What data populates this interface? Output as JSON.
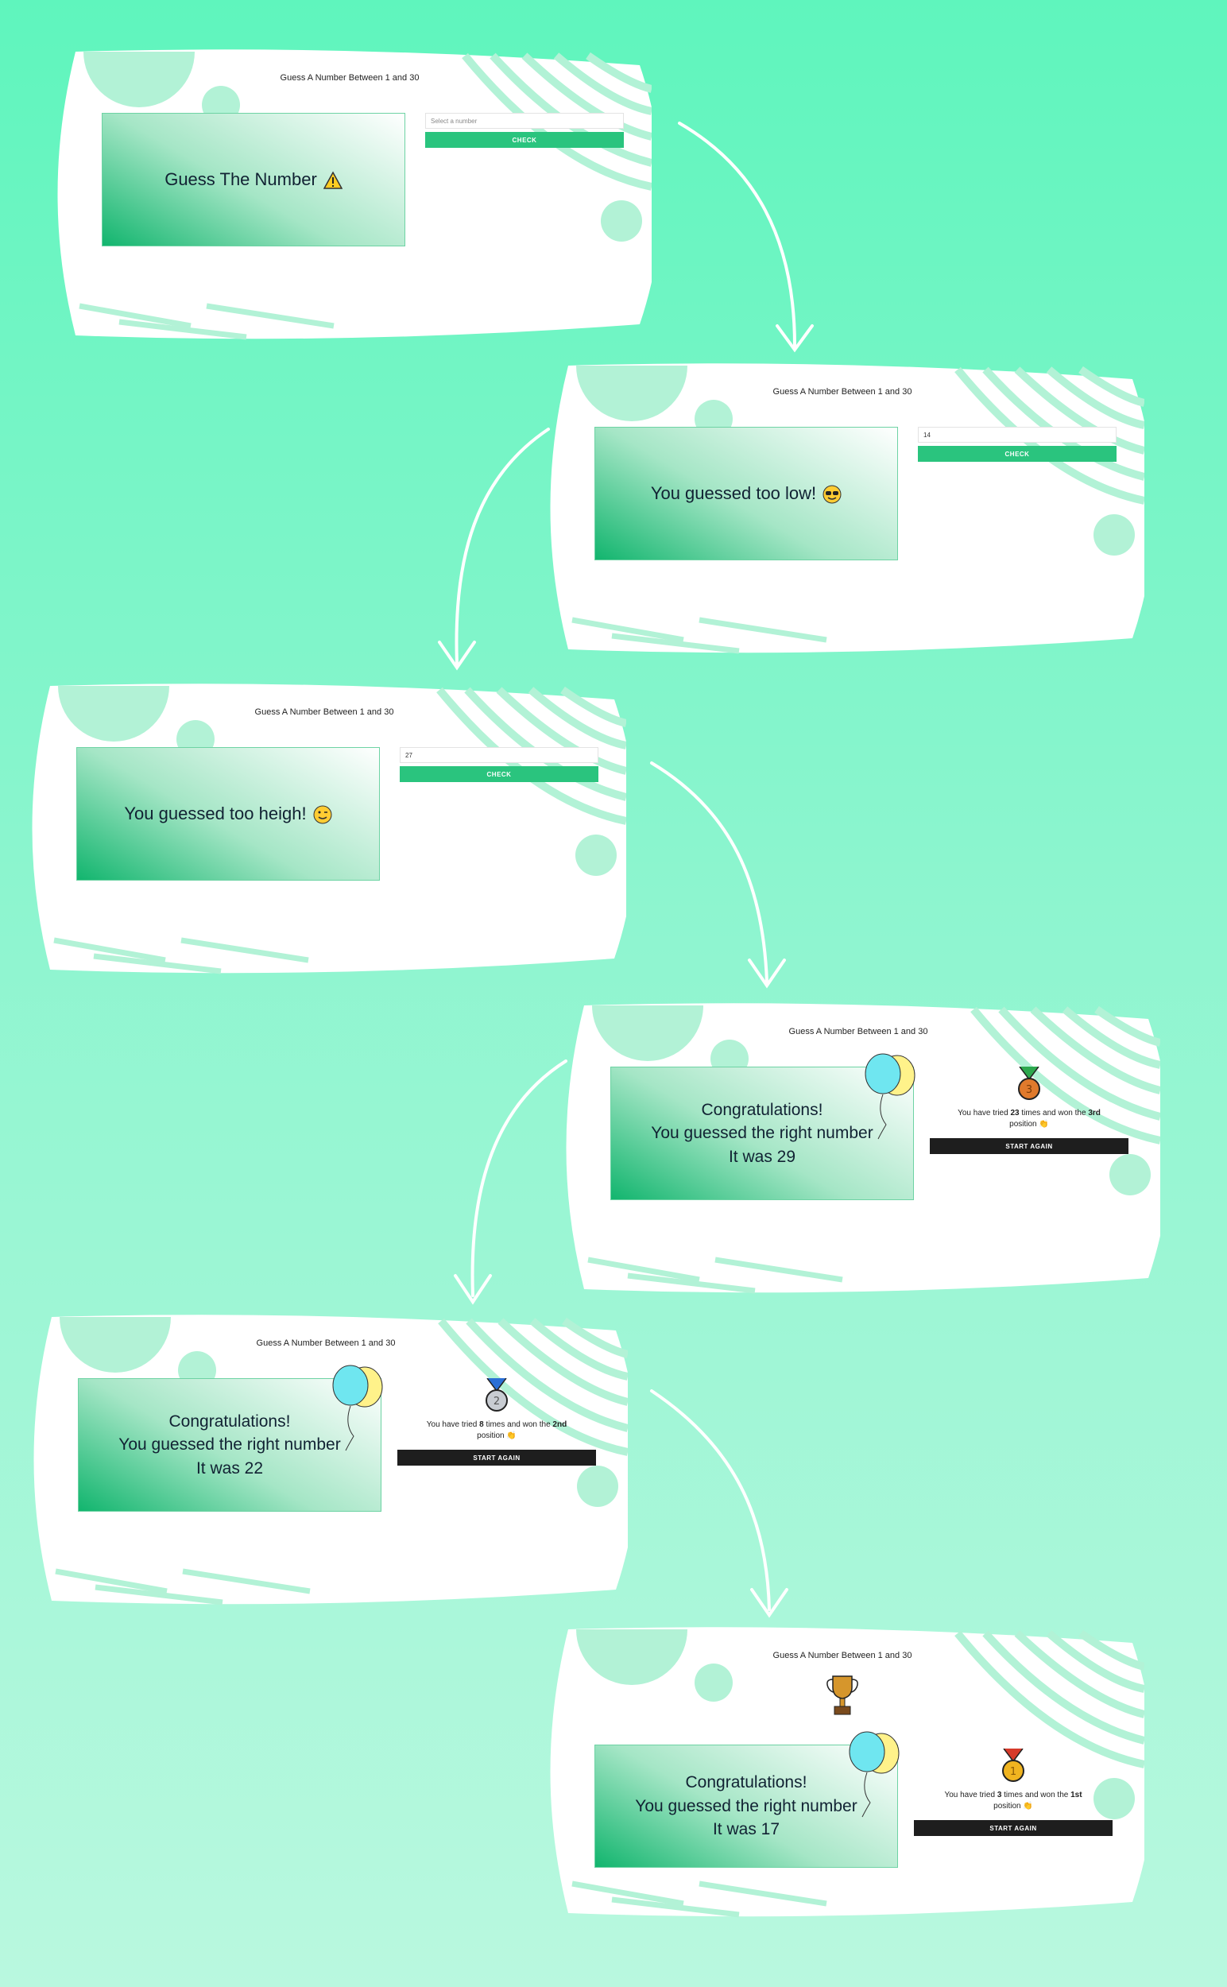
{
  "heading": "Guess A Number Between 1 and 30",
  "check_label": "CHECK",
  "start_again_label": "START AGAIN",
  "placeholder": "Select a number",
  "colors": {
    "accent": "#2ac47e",
    "dark_button": "#1e1e1e",
    "background_top": "#5ff5bd",
    "background_bottom": "#b9f8df"
  },
  "screens": [
    {
      "id": "intro",
      "card_text": "Guess The Number",
      "emoji": "warning-icon",
      "input_value": ""
    },
    {
      "id": "too-low",
      "card_text": "You guessed too low!",
      "emoji": "sunglasses-face-icon",
      "input_value": "14"
    },
    {
      "id": "too-high",
      "card_text": "You guessed too heigh!",
      "emoji": "winking-face-icon",
      "input_value": "27"
    },
    {
      "id": "win-3rd",
      "line1": "Congratulations!",
      "line2": "You guessed the right number",
      "line3": "It was 29",
      "result_pre": "You have tried ",
      "result_tries": "23",
      "result_mid": " times and won the ",
      "result_pos": "3rd",
      "result_post": " position",
      "medal": "third-place-medal-icon"
    },
    {
      "id": "win-2nd",
      "line1": "Congratulations!",
      "line2": "You guessed the right number",
      "line3": "It was 22",
      "result_pre": "You have tried ",
      "result_tries": "8",
      "result_mid": " times and won the ",
      "result_pos": "2nd",
      "result_post": " position",
      "medal": "second-place-medal-icon"
    },
    {
      "id": "win-1st",
      "line1": "Congratulations!",
      "line2": "You guessed the right number",
      "line3": "It was 17",
      "result_pre": "You have tried ",
      "result_tries": "3",
      "result_mid": " times and won the ",
      "result_pos": "1st",
      "result_post": " position",
      "medal": "first-place-medal-icon",
      "trophy": "trophy-icon"
    }
  ]
}
